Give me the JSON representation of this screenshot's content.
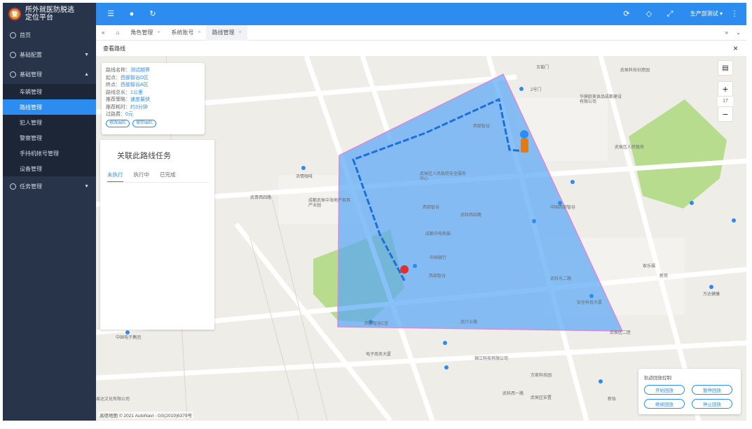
{
  "app": {
    "title_line1": "所外就医防脱逃",
    "title_line2": "定位平台",
    "badge_text": "警"
  },
  "sidebar": {
    "menu": [
      {
        "label": "首页",
        "icon": "home-icon"
      },
      {
        "label": "基础配置",
        "icon": "settings-icon"
      },
      {
        "label": "基础管理",
        "icon": "gear-icon"
      }
    ],
    "submenu": [
      "车辆管理",
      "路线管理",
      "犯人管理",
      "警察管理",
      "手持机帐号管理",
      "设备管理"
    ],
    "active_submenu": "路线管理",
    "task_menu": {
      "label": "任务管理",
      "icon": "task-icon"
    }
  },
  "topbar": {
    "user": "生产部测试"
  },
  "tabs": [
    {
      "label": "角色管理"
    },
    {
      "label": "系统账号"
    },
    {
      "label": "路线管理",
      "active": true
    }
  ],
  "page": {
    "title": "查看路线"
  },
  "route_info": {
    "name_label": "路线名称：",
    "name": "测试越界",
    "start_label": "起点：",
    "start": "西部智谷D区",
    "end_label": "终点：",
    "end": "西部智谷A区",
    "length_label": "路线总长：",
    "length": "1公里",
    "strategy_label": "推荐策略：",
    "strategy": "速度最快",
    "time_label": "推荐耗时：",
    "time": "约3分钟",
    "toll_label": "过路费：",
    "toll": "0元",
    "btn_edit": "修改围栏",
    "btn_save": "保存围栏"
  },
  "task_panel": {
    "title": "关联此路线任务",
    "tabs": [
      "未执行",
      "执行中",
      "已完成"
    ]
  },
  "map_labels": [
    "玉菊门",
    "2号门",
    "武侯科技创意园",
    "华鼎欧美食品成都建设有限公司",
    "西部智谷",
    "成都武侯中海地产家具产业园",
    "浓情咖啡",
    "武侯区人民政府安全服务中心",
    "武青西四路",
    "西部智谷",
    "成都中电熊猫",
    "中国银行",
    "西部智谷",
    "西部智谷C区",
    "武兴五路",
    "武科西四路",
    "武科东二路",
    "中国西部智谷",
    "安全科技大厦",
    "电子商务大厦",
    "锦江科技有限公司",
    "武科西一路",
    "家乐福",
    "新苑",
    "武侯区二医",
    "万家科技园",
    "易达文化有限公司",
    "中国电子集团",
    "万达健康",
    "武侯区安置",
    "新怡",
    "武侯区人民政府"
  ],
  "map_attribution": "高德地图 © 2021 AutoNavi - GS(2019)6379号",
  "zoom": {
    "level": "17",
    "plus": "+",
    "minus": "−"
  },
  "playback": {
    "title": "轨迹回放控制",
    "buttons": [
      "开始回放",
      "暂停回放",
      "继续回放",
      "停止回放"
    ]
  },
  "colors": {
    "accent": "#2d8cf0",
    "sidebar": "#27344a",
    "fence_fill": "#5aa7f5",
    "fence_stroke": "#d98bd9",
    "route": "#1e6fd9"
  }
}
